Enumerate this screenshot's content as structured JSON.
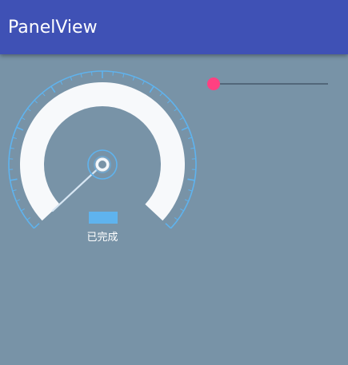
{
  "app_bar": {
    "title": "PanelView",
    "color": "#3f51b5"
  },
  "panel": {
    "status_text": "已完成",
    "progress": 0.0,
    "needle_color": "#d7e6f3",
    "arc_color": "#f7f9fb",
    "tick_color": "#5fb3ee",
    "indicator_color": "#5fb3ee"
  },
  "seekbar": {
    "progress": 0.0,
    "accent_color": "#ff4081",
    "track_color": "#52677a"
  },
  "background_color": "#7893a7"
}
